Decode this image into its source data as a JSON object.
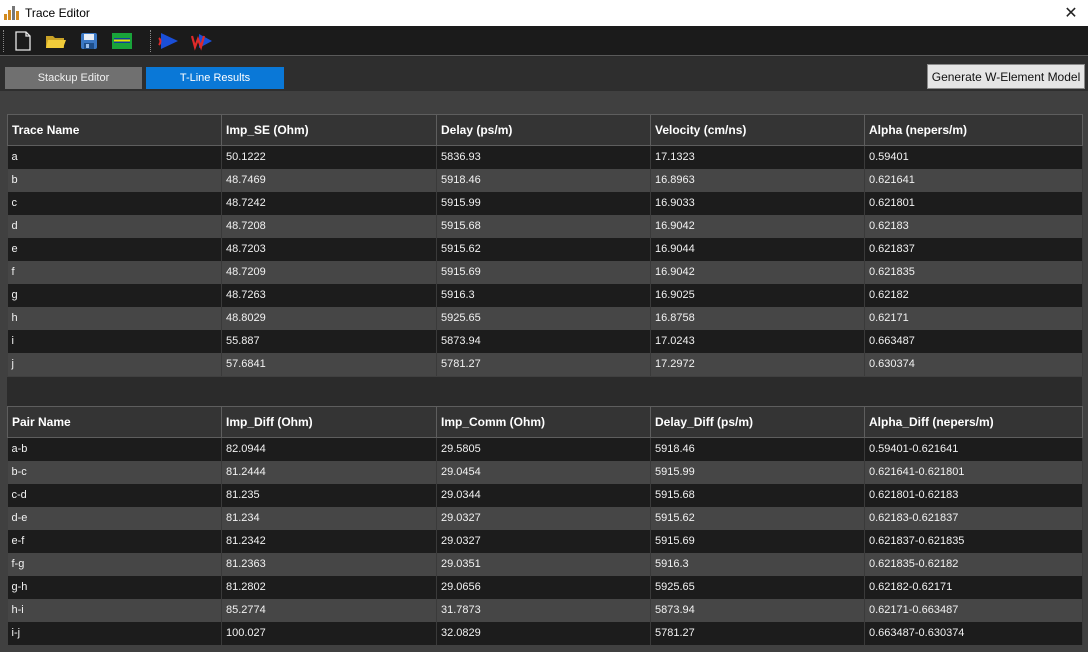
{
  "window": {
    "title": "Trace Editor",
    "close_glyph": "✕"
  },
  "toolbar": {
    "buttons": [
      {
        "name": "new-file-icon"
      },
      {
        "name": "open-folder-icon"
      },
      {
        "name": "save-icon"
      },
      {
        "name": "layer-icon"
      },
      {
        "name": "trace-run-icon"
      },
      {
        "name": "w-element-icon"
      }
    ]
  },
  "tabs": {
    "stackup": "Stackup Editor",
    "tline": "T-Line Results",
    "active": "tline"
  },
  "generate_button": "Generate W-Element Model",
  "trace_table": {
    "headers": [
      "Trace Name",
      "Imp_SE (Ohm)",
      "Delay (ps/m)",
      "Velocity (cm/ns)",
      "Alpha (nepers/m)"
    ],
    "rows": [
      [
        "a",
        "50.1222",
        "5836.93",
        "17.1323",
        "0.59401"
      ],
      [
        "b",
        "48.7469",
        "5918.46",
        "16.8963",
        "0.621641"
      ],
      [
        "c",
        "48.7242",
        "5915.99",
        "16.9033",
        "0.621801"
      ],
      [
        "d",
        "48.7208",
        "5915.68",
        "16.9042",
        "0.62183"
      ],
      [
        "e",
        "48.7203",
        "5915.62",
        "16.9044",
        "0.621837"
      ],
      [
        "f",
        "48.7209",
        "5915.69",
        "16.9042",
        "0.621835"
      ],
      [
        "g",
        "48.7263",
        "5916.3",
        "16.9025",
        "0.62182"
      ],
      [
        "h",
        "48.8029",
        "5925.65",
        "16.8758",
        "0.62171"
      ],
      [
        "i",
        "55.887",
        "5873.94",
        "17.0243",
        "0.663487"
      ],
      [
        "j",
        "57.6841",
        "5781.27",
        "17.2972",
        "0.630374"
      ]
    ]
  },
  "pair_table": {
    "headers": [
      "Pair Name",
      "Imp_Diff (Ohm)",
      "Imp_Comm (Ohm)",
      "Delay_Diff (ps/m)",
      "Alpha_Diff (nepers/m)"
    ],
    "rows": [
      [
        "a-b",
        "82.0944",
        "29.5805",
        "5918.46",
        "0.59401-0.621641"
      ],
      [
        "b-c",
        "81.2444",
        "29.0454",
        "5915.99",
        "0.621641-0.621801"
      ],
      [
        "c-d",
        "81.235",
        "29.0344",
        "5915.68",
        "0.621801-0.62183"
      ],
      [
        "d-e",
        "81.234",
        "29.0327",
        "5915.62",
        "0.62183-0.621837"
      ],
      [
        "e-f",
        "81.2342",
        "29.0327",
        "5915.69",
        "0.621837-0.621835"
      ],
      [
        "f-g",
        "81.2363",
        "29.0351",
        "5916.3",
        "0.621835-0.62182"
      ],
      [
        "g-h",
        "81.2802",
        "29.0656",
        "5925.65",
        "0.62182-0.62171"
      ],
      [
        "h-i",
        "85.2774",
        "31.7873",
        "5873.94",
        "0.62171-0.663487"
      ],
      [
        "i-j",
        "100.027",
        "32.0829",
        "5781.27",
        "0.663487-0.630374"
      ]
    ]
  },
  "colors": {
    "active_tab": "#0a78d7",
    "inactive_tab": "#707070",
    "row_dark": "#1c1c1c",
    "row_light": "#464646",
    "header_bg": "#343434"
  }
}
